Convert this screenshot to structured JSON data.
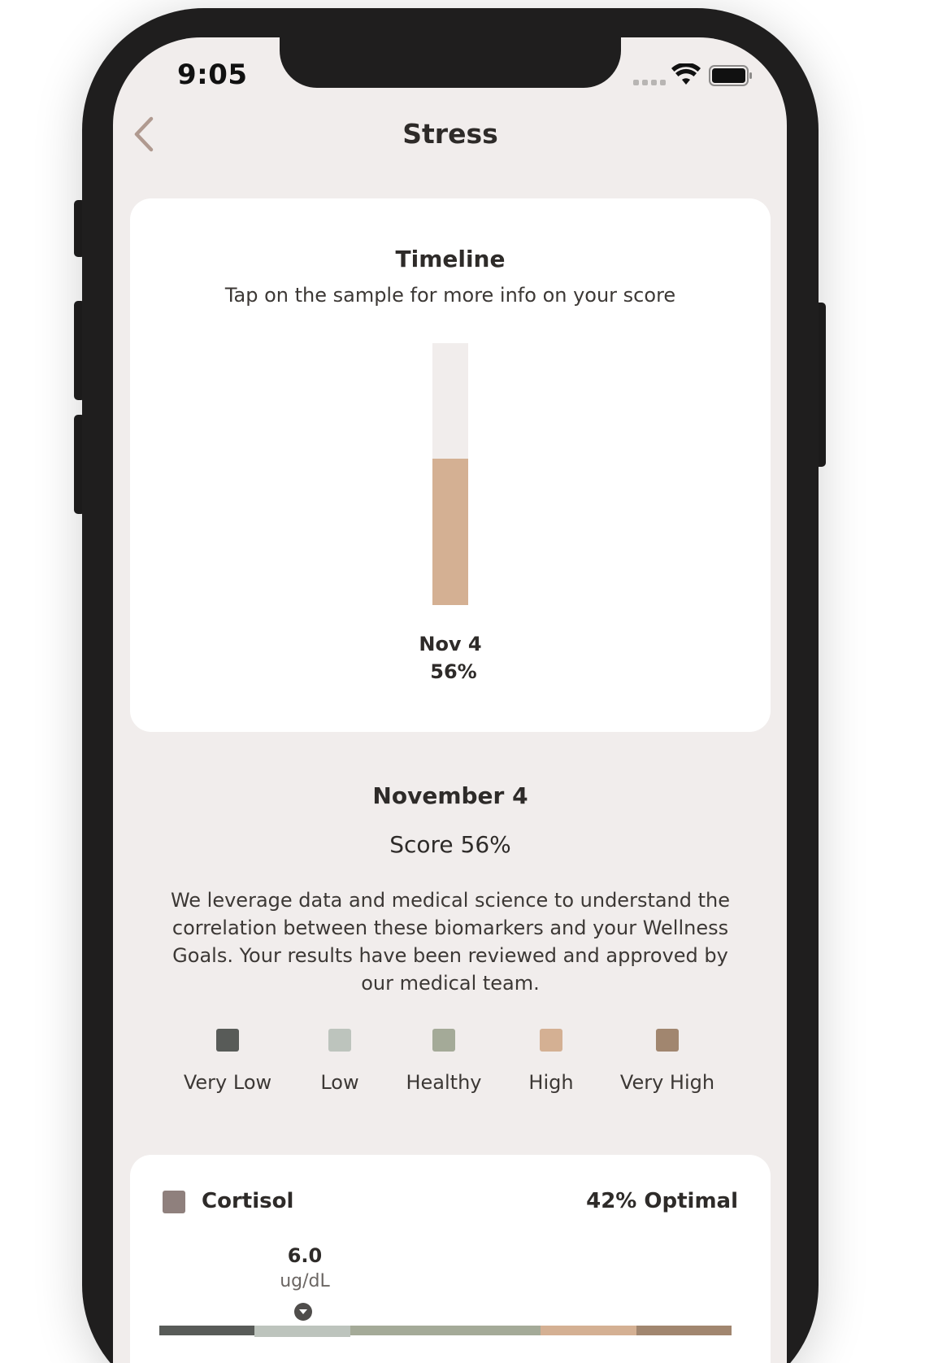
{
  "status_bar": {
    "time": "9:05",
    "icons": [
      "signal-dots-icon",
      "wifi-icon",
      "battery-icon"
    ]
  },
  "header": {
    "title": "Stress",
    "back_icon": "chevron-left-icon"
  },
  "timeline": {
    "title": "Timeline",
    "subtitle": "Tap on the sample for more info on your score",
    "samples": [
      {
        "date": "Nov 4",
        "score_label": "56%",
        "score": 0.56,
        "color": "#d4b093"
      }
    ],
    "track_color": "#f1edec"
  },
  "detail": {
    "date": "November 4",
    "score": "Score 56%",
    "description": "We leverage data and medical science to understand the correlation between these biomarkers and your Wellness Goals. Your results have been reviewed and approved by our medical team."
  },
  "legend": [
    {
      "label": "Very Low",
      "color": "#585b58"
    },
    {
      "label": "Low",
      "color": "#bdc4bd"
    },
    {
      "label": "Healthy",
      "color": "#a4aa98"
    },
    {
      "label": "High",
      "color": "#d4b093"
    },
    {
      "label": "Very High",
      "color": "#a1866f"
    }
  ],
  "biomarker": {
    "name": "Cortisol",
    "swatch_color": "#8f807d",
    "optimal": "42% Optimal",
    "value": "6.0",
    "unit": "ug/dL",
    "range_segments": [
      {
        "level": "Very Low",
        "color": "#585b58"
      },
      {
        "level": "Low",
        "color": "#bdc4bd"
      },
      {
        "level": "Healthy",
        "color": "#a4aa98"
      },
      {
        "level": "Healthy",
        "color": "#a4aa98"
      },
      {
        "level": "High",
        "color": "#d4b093"
      },
      {
        "level": "Very High",
        "color": "#a1866f"
      }
    ],
    "active_level": "Low"
  }
}
